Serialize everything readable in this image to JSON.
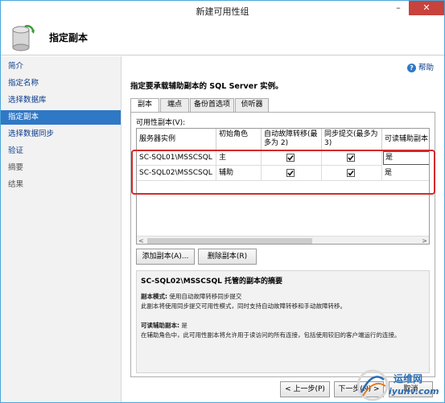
{
  "window": {
    "title": "新建可用性组"
  },
  "header": {
    "title": "指定副本"
  },
  "sidebar": {
    "items": [
      {
        "label": "简介",
        "state": "link"
      },
      {
        "label": "指定名称",
        "state": "link"
      },
      {
        "label": "选择数据库",
        "state": "link"
      },
      {
        "label": "指定副本",
        "state": "active"
      },
      {
        "label": "选择数据同步",
        "state": "link"
      },
      {
        "label": "验证",
        "state": "link"
      },
      {
        "label": "摘要",
        "state": "disabled"
      },
      {
        "label": "结果",
        "state": "disabled"
      }
    ]
  },
  "main": {
    "help_label": "帮助",
    "instruction": "指定要承载辅助副本的 SQL Server 实例。",
    "tabs": [
      "副本",
      "端点",
      "备份首选项",
      "侦听器"
    ],
    "group_label": "可用性副本(V):",
    "columns": [
      "服务器实例",
      "初始角色",
      "自动故障转移(最多为 2)",
      "同步提交(最多为 3)",
      "可读辅助副本"
    ],
    "rows": [
      {
        "server": "SC-SQL01\\MSSCSQL",
        "role": "主",
        "auto_failover": true,
        "sync_commit": true,
        "readable": "是"
      },
      {
        "server": "SC-SQL02\\MSSCSQL",
        "role": "辅助",
        "auto_failover": true,
        "sync_commit": true,
        "readable": "是"
      }
    ],
    "add_button": "添加副本(A)...",
    "remove_button": "删除副本(R)",
    "summary": {
      "title": "SC-SQL02\\MSSCSQL 托管的副本的摘要",
      "mode_label": "副本模式:",
      "mode_value": "使用自动故障转移同步提交",
      "mode_desc": "此副本将使用同步提交可用性模式，同时支持自动故障转移和手动故障转移。",
      "readable_label": "可读辅助副本:",
      "readable_value": "是",
      "readable_desc": "在辅助角色中，此可用性副本将允许用于读访问的所有连接，包括使用较旧的客户端运行的连接。"
    }
  },
  "footer": {
    "prev": "< 上一步(P)",
    "next": "下一步(N) >",
    "cancel": "取消"
  },
  "watermark": {
    "line1": "运维网",
    "line2": "iyunv.com"
  },
  "colors": {
    "accent": "#2f78c6",
    "highlight_box": "#d42b2b",
    "close_button": "#c7433b"
  }
}
